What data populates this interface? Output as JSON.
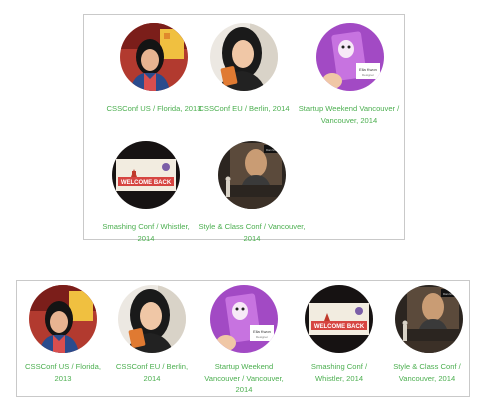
{
  "layouts": {
    "wide_grid": {
      "items": [
        {
          "caption": "CSSConf US / Florida, 2013",
          "photo": "woman-smiling-red-backdrop"
        },
        {
          "caption": "CSSConf EU / Berlin, 2014",
          "photo": "woman-holding-orange-card"
        },
        {
          "caption": "Startup Weekend Vancouver / Vancouver, 2014",
          "photo": "purple-cartoon-card-ella-kwon"
        },
        {
          "caption": "Smashing Conf / Whistler, 2014",
          "photo": "welcome-back-slide"
        },
        {
          "caption": "Style & Class Conf / Vancouver, 2014",
          "photo": "speaker-on-stage"
        }
      ]
    },
    "single_row": {
      "items": [
        {
          "caption": "CSSConf US / Florida, 2013",
          "photo": "woman-smiling-red-backdrop"
        },
        {
          "caption": "CSSConf EU / Berlin, 2014",
          "photo": "woman-holding-orange-card"
        },
        {
          "caption": "Startup Weekend Vancouver / Vancouver, 2014",
          "photo": "purple-cartoon-card-ella-kwon"
        },
        {
          "caption": "Smashing Conf / Whistler, 2014",
          "photo": "welcome-back-slide"
        },
        {
          "caption": "Style & Class Conf / Vancouver, 2014",
          "photo": "speaker-on-stage"
        }
      ]
    }
  },
  "slide_text": {
    "welcome": "WELCOME BACK",
    "card_name": "Ella Kwon",
    "card_sub": "Designer",
    "screen_name": "Dan Mall"
  },
  "colors": {
    "caption": "#4caf50",
    "border": "#c9c9c9"
  }
}
